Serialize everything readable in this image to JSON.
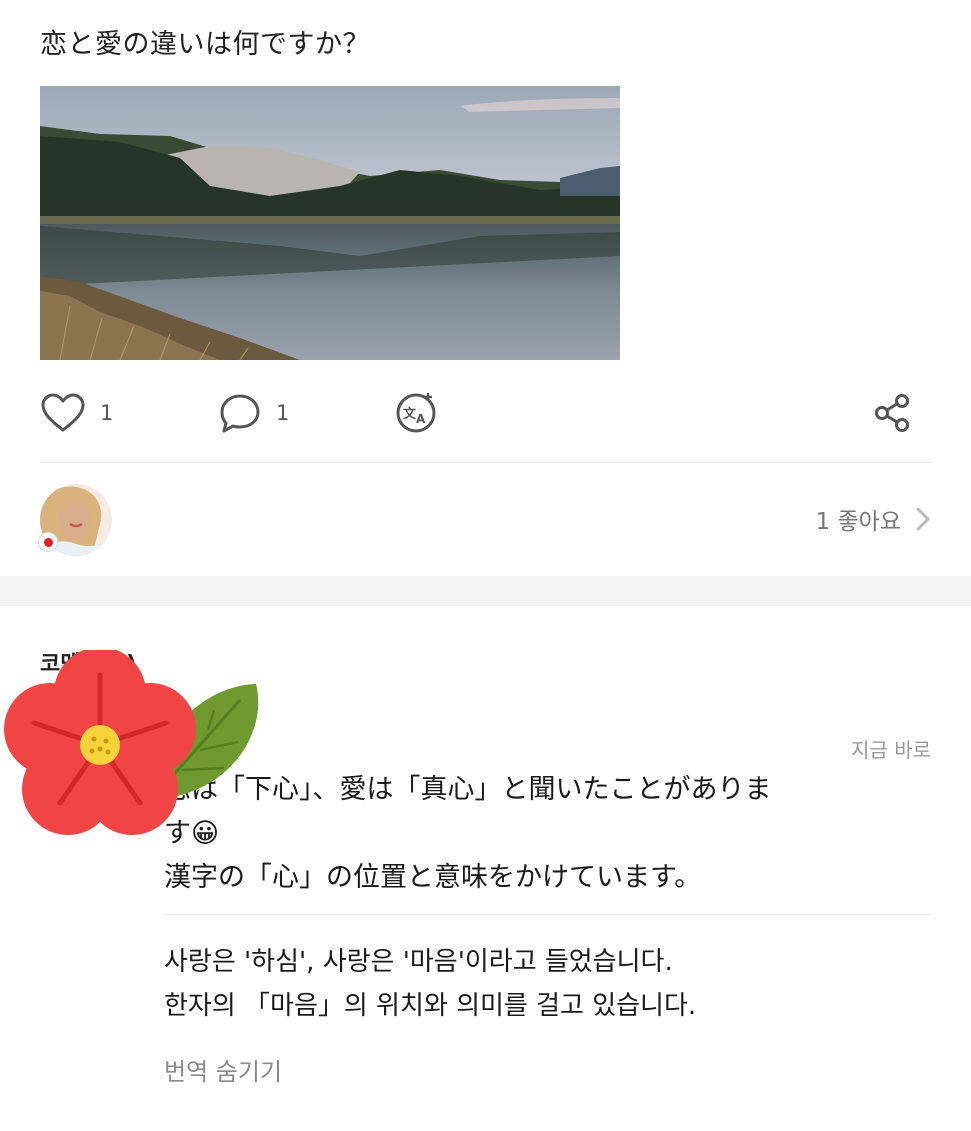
{
  "post": {
    "title": "恋と愛の違いは何ですか？"
  },
  "actions": {
    "like_count": "1",
    "comment_count": "1",
    "like_icon": "heart-outline-icon",
    "comment_icon": "speech-bubble-icon",
    "translate_icon": "translate-icon",
    "share_icon": "share-icon"
  },
  "likes": {
    "summary": "1 좋아요"
  },
  "comments": {
    "header": "코멘트(1)",
    "items": [
      {
        "time": "지금 바로",
        "lines": [
          "恋は「下心」、愛は「真心」と聞いたことがありま",
          "す😀",
          "漢字の「心」の位置と意味をかけています。"
        ],
        "translation_lines": [
          "사랑은 '하심', 사랑은 '마음'이라고 들었습니다.",
          "한자의 「마음」의 위치와 의미를 걸고 있습니다."
        ],
        "hide_translation": "번역 숨기기"
      }
    ]
  },
  "colors": {
    "flower_petal": "#f14545",
    "leaf": "#6f9a2f",
    "divider": "#e6e6e6"
  }
}
